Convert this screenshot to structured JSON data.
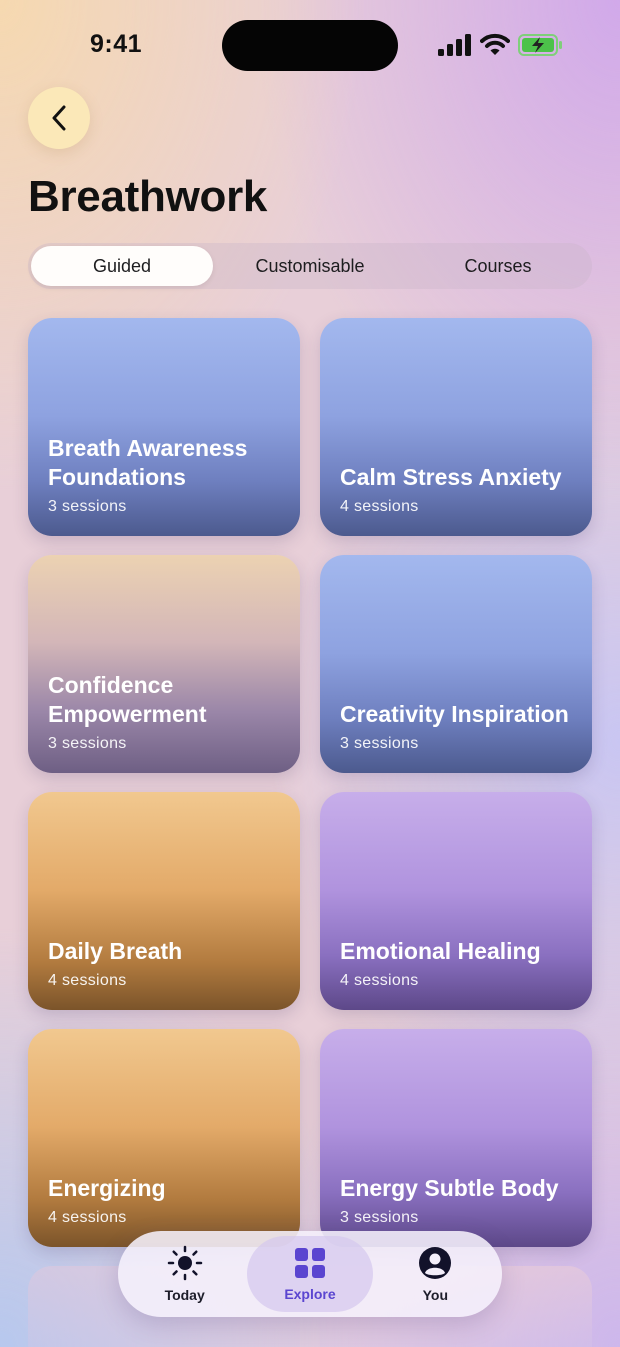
{
  "status_bar": {
    "time": "9:41"
  },
  "header": {
    "title": "Breathwork"
  },
  "segments": [
    {
      "label": "Guided",
      "active": true
    },
    {
      "label": "Customisable",
      "active": false
    },
    {
      "label": "Courses",
      "active": false
    }
  ],
  "cards": [
    {
      "title": "Breath Awareness Foundations",
      "sessions": "3 sessions"
    },
    {
      "title": "Calm Stress Anxiety",
      "sessions": "4 sessions"
    },
    {
      "title": "Confidence Empowerment",
      "sessions": "3 sessions"
    },
    {
      "title": "Creativity Inspiration",
      "sessions": "3 sessions"
    },
    {
      "title": "Daily Breath",
      "sessions": "4 sessions"
    },
    {
      "title": "Emotional Healing",
      "sessions": "4 sessions"
    },
    {
      "title": "Energizing",
      "sessions": "4 sessions"
    },
    {
      "title": "Energy Subtle Body",
      "sessions": "3 sessions"
    }
  ],
  "tabbar": {
    "items": [
      {
        "label": "Today",
        "icon": "sun-icon"
      },
      {
        "label": "Explore",
        "icon": "grid-icon"
      },
      {
        "label": "You",
        "icon": "person-icon"
      }
    ],
    "active": "Explore"
  },
  "colors": {
    "accent": "#5a45d0",
    "back_button": "#fbe8b8"
  }
}
